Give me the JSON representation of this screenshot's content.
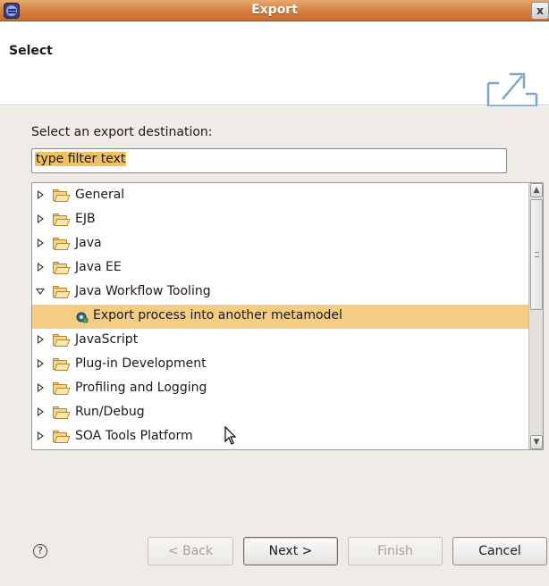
{
  "window": {
    "title": "Export",
    "close_glyph": "x"
  },
  "header": {
    "title": "Select",
    "icon": "export-icon"
  },
  "destination": {
    "label": "Select an export destination:",
    "filter_value": "type filter text"
  },
  "tree": {
    "items": [
      {
        "label": "General",
        "expanded": false,
        "selected": false
      },
      {
        "label": "EJB",
        "expanded": false,
        "selected": false
      },
      {
        "label": "Java",
        "expanded": false,
        "selected": false
      },
      {
        "label": "Java EE",
        "expanded": false,
        "selected": false
      },
      {
        "label": "Java Workflow Tooling",
        "expanded": true,
        "selected": false
      },
      {
        "label": "Export process into another metamodel",
        "child": true,
        "selected": true
      },
      {
        "label": "JavaScript",
        "expanded": false,
        "selected": false
      },
      {
        "label": "Plug-in Development",
        "expanded": false,
        "selected": false
      },
      {
        "label": "Profiling and Logging",
        "expanded": false,
        "selected": false
      },
      {
        "label": "Run/Debug",
        "expanded": false,
        "selected": false
      },
      {
        "label": "SOA Tools Platform",
        "expanded": false,
        "selected": false
      }
    ],
    "selection_color": "#f4cc83"
  },
  "buttons": {
    "help": "?",
    "back": "< Back",
    "next": "Next >",
    "finish": "Finish",
    "cancel": "Cancel"
  },
  "colors": {
    "titlebar": "#d57f3f",
    "body_bg": "#efebe7",
    "filter_highlight": "#f1c05f"
  }
}
